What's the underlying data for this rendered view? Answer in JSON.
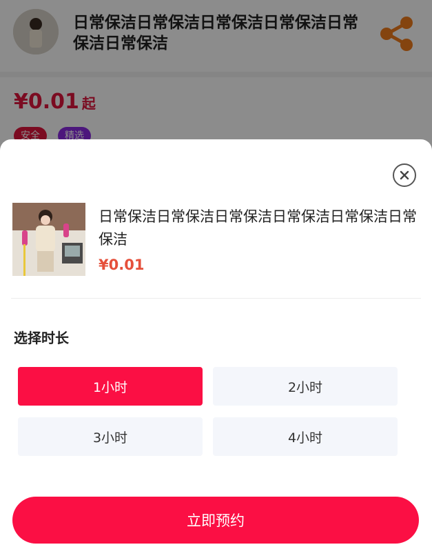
{
  "background_page": {
    "title": "日常保洁日常保洁日常保洁日常保洁日常保洁日常保洁",
    "price": "¥0.01",
    "price_suffix": "起",
    "tags": [
      "安全",
      "精选"
    ],
    "share_icon": "share-icon"
  },
  "sheet": {
    "close_icon": "close-icon",
    "product": {
      "title": "日常保洁日常保洁日常保洁日常保洁日常保洁日常保洁",
      "price": "¥0.01"
    },
    "section_title": "选择时长",
    "options": [
      {
        "label": "1小时",
        "selected": true
      },
      {
        "label": "2小时",
        "selected": false
      },
      {
        "label": "3小时",
        "selected": false
      },
      {
        "label": "4小时",
        "selected": false
      }
    ],
    "book_button": "立即预约"
  },
  "colors": {
    "accent": "#fb0f44",
    "price": "#e5503b",
    "share": "#f07d1d",
    "option_bg": "#f4f6fb"
  }
}
